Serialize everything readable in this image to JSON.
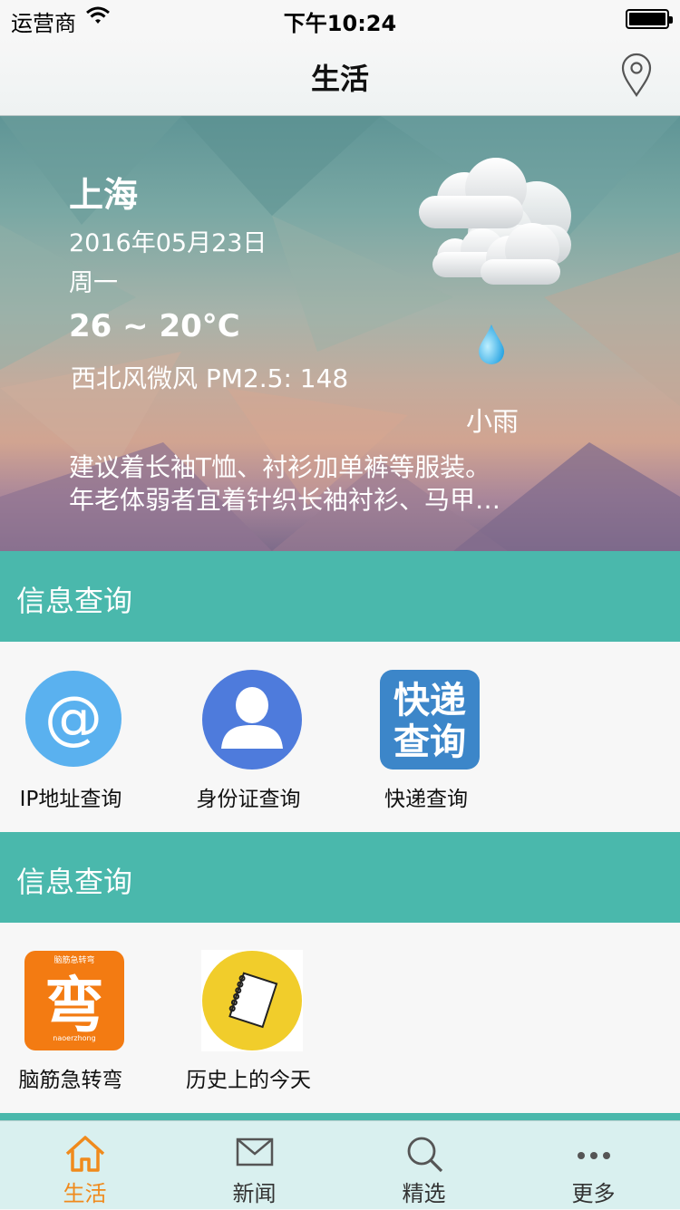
{
  "status_bar": {
    "carrier": "运营商",
    "time": "下午10:24"
  },
  "nav": {
    "title": "生活",
    "location_icon": "location-pin-icon"
  },
  "weather": {
    "city": "上海",
    "date": "2016年05月23日",
    "weekday": "周一",
    "temperature": "26 ~ 20°C",
    "wind_pm": "西北风微风 PM2.5: 148",
    "condition": "小雨",
    "advice_line1": "建议着长袖T恤、衬衫加单裤等服装。",
    "advice_line2": "年老体弱者宜着针织长袖衬衫、马甲…",
    "icons": [
      "cloudy-icon",
      "rain-drop-icon"
    ]
  },
  "sections": [
    {
      "title": "信息查询",
      "items": [
        {
          "label": "IP地址查询",
          "icon": "at-sign-icon"
        },
        {
          "label": "身份证查询",
          "icon": "person-icon"
        },
        {
          "label": "快递查询",
          "icon": "express-query-icon",
          "icon_text": "快递查询"
        }
      ]
    },
    {
      "title": "信息查询",
      "items": [
        {
          "label": "脑筋急转弯",
          "icon": "brain-teaser-icon",
          "icon_text": "弯",
          "icon_small_top": "脑筋急转弯",
          "icon_small_bottom": "naoerzhong"
        },
        {
          "label": "历史上的今天",
          "icon": "notebook-icon"
        }
      ]
    }
  ],
  "tab_bar": {
    "tabs": [
      {
        "label": "生活",
        "icon": "home-icon",
        "active": true
      },
      {
        "label": "新闻",
        "icon": "mail-icon",
        "active": false
      },
      {
        "label": "精选",
        "icon": "search-icon",
        "active": false
      },
      {
        "label": "更多",
        "icon": "more-dots-icon",
        "active": false
      }
    ]
  },
  "colors": {
    "section_header": "#4ab8ac",
    "active_tab": "#f08a1c",
    "tab_bar_bg": "#d9f0ef"
  }
}
